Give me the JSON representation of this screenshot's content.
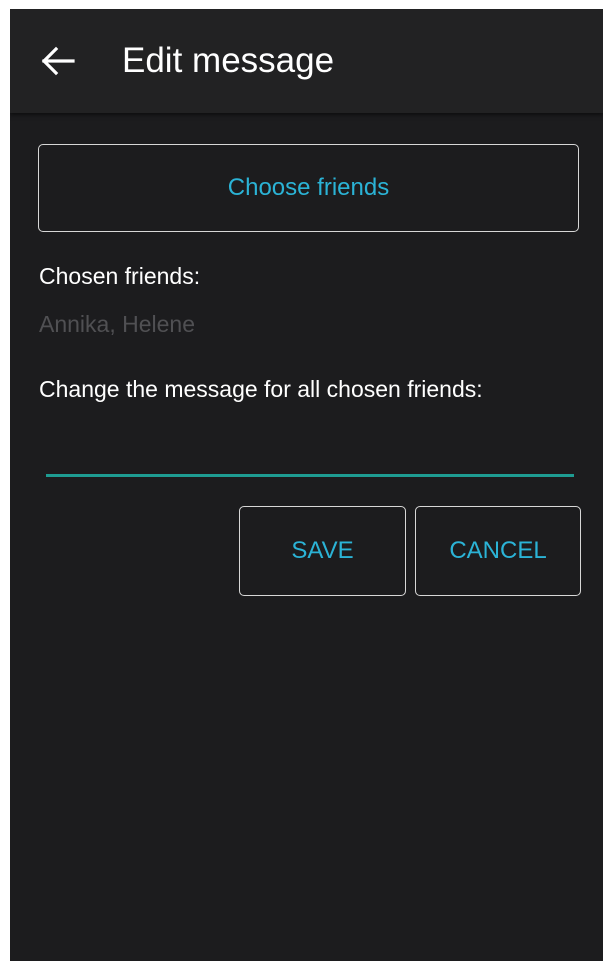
{
  "appbar": {
    "title": "Edit message",
    "back_icon": "arrow-left-icon"
  },
  "choose_friends": {
    "label": "Choose friends"
  },
  "chosen": {
    "label": "Chosen friends:",
    "value": "Annika, Helene"
  },
  "message": {
    "label": "Change the message for all chosen friends:",
    "value": ""
  },
  "actions": {
    "save_label": "SAVE",
    "cancel_label": "CANCEL"
  },
  "colors": {
    "accent_text": "#2bb3d6",
    "input_underline": "#1e9c92",
    "background": "#1c1c1e",
    "appbar": "#222223"
  }
}
